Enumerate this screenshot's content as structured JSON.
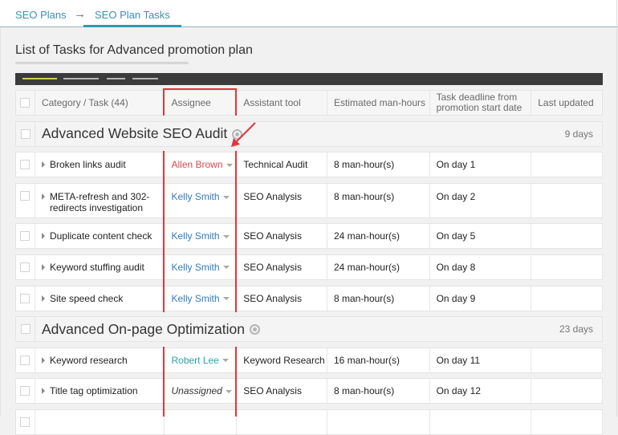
{
  "breadcrumb": {
    "items": [
      {
        "label": "SEO Plans"
      },
      {
        "label": "SEO Plan Tasks"
      }
    ],
    "separator": "→",
    "active_index": 1
  },
  "page_title": "List of Tasks for Advanced promotion plan",
  "table": {
    "columns": {
      "task": "Category / Task (44)",
      "assignee": "Assignee",
      "tool": "Assistant tool",
      "hours": "Estimated man-hours",
      "deadline": "Task deadline from promotion start date",
      "updated": "Last updated"
    },
    "groups": [
      {
        "name": "Advanced Website SEO Audit",
        "duration": "9 days",
        "tasks": [
          {
            "name": "Broken links audit",
            "assignee": "Allen Brown",
            "assignee_style": "highlighted",
            "tool": "Technical Audit",
            "hours": "8 man-hour(s)",
            "deadline": "On day 1",
            "updated": ""
          },
          {
            "name": "META-refresh and 302-redirects investigation",
            "assignee": "Kelly Smith",
            "assignee_style": "user",
            "tool": "SEO Analysis",
            "hours": "8 man-hour(s)",
            "deadline": "On day 2",
            "updated": ""
          },
          {
            "name": "Duplicate content check",
            "assignee": "Kelly Smith",
            "assignee_style": "user",
            "tool": "SEO Analysis",
            "hours": "24 man-hour(s)",
            "deadline": "On day 5",
            "updated": ""
          },
          {
            "name": "Keyword stuffing audit",
            "assignee": "Kelly Smith",
            "assignee_style": "user",
            "tool": "SEO Analysis",
            "hours": "24 man-hour(s)",
            "deadline": "On day 8",
            "updated": ""
          },
          {
            "name": "Site speed check",
            "assignee": "Kelly Smith",
            "assignee_style": "user",
            "tool": "SEO Analysis",
            "hours": "8 man-hour(s)",
            "deadline": "On day 9",
            "updated": ""
          }
        ]
      },
      {
        "name": "Advanced On-page Optimization",
        "duration": "23 days",
        "tasks": [
          {
            "name": "Keyword research",
            "assignee": "Robert Lee",
            "assignee_style": "alt-user",
            "tool": "Keyword Research",
            "hours": "16 man-hour(s)",
            "deadline": "On day 11",
            "updated": ""
          },
          {
            "name": "Title tag optimization",
            "assignee": "Unassigned",
            "assignee_style": "unassigned",
            "tool": "SEO Analysis",
            "hours": "8 man-hour(s)",
            "deadline": "On day 12",
            "updated": ""
          },
          {
            "name": "",
            "assignee": "",
            "assignee_style": "empty",
            "tool": "",
            "hours": "",
            "deadline": "",
            "updated": ""
          }
        ]
      }
    ]
  },
  "colors": {
    "link": "#3d8fb3",
    "highlighted": "#e0474c",
    "user": "#2f7bbd",
    "alt-user": "#2ba5a3",
    "unassigned": "#333333",
    "annotation": "#e0363c",
    "toolbar_active": "#c9d05a"
  },
  "icons": {
    "row_expand": "caret-right-icon",
    "assignee_dropdown": "caret-down-icon",
    "category_settings": "gear-icon",
    "breadcrumb_separator": "arrow-right-icon"
  }
}
